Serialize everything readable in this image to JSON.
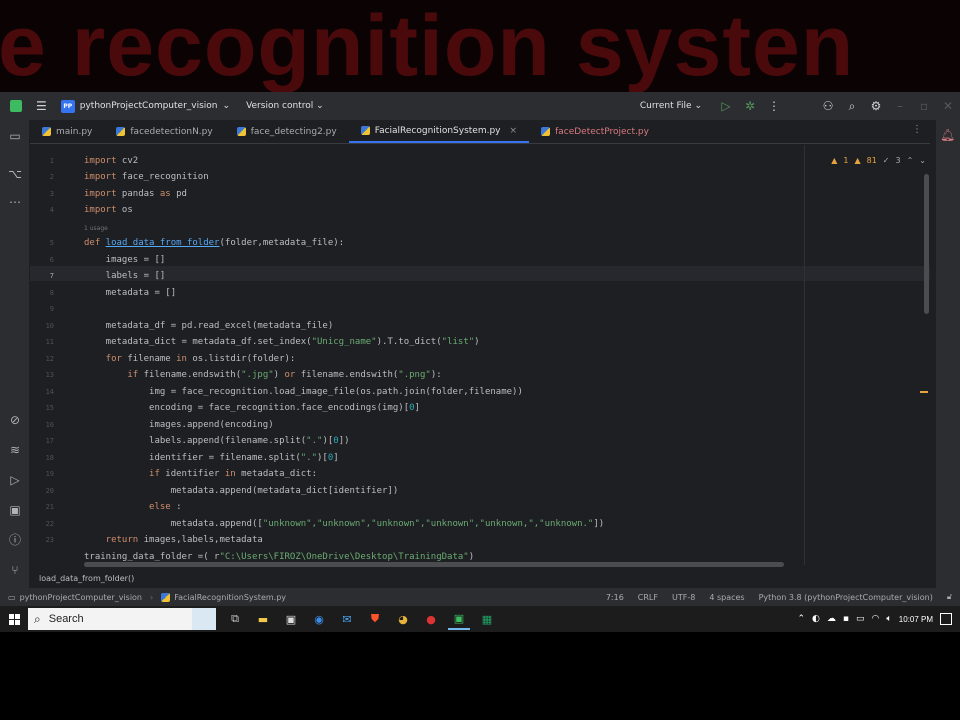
{
  "banner": {
    "text": "e recognition systen"
  },
  "titlebar": {
    "project": "pythonProjectComputer_vision",
    "project_badge": "PP",
    "vcs": "Version control",
    "run_config": "Current File"
  },
  "tabs": [
    {
      "label": "main.py"
    },
    {
      "label": "facedetectionN.py"
    },
    {
      "label": "face_detecting2.py"
    },
    {
      "label": "FacialRecognitionSystem.py",
      "active": true
    },
    {
      "label": "faceDetectProject.py"
    }
  ],
  "inspection": {
    "warnings": "1",
    "weak_warnings": "81",
    "typos": "3"
  },
  "code": {
    "line_numbers": [
      "1",
      "2",
      "3",
      "4",
      "5",
      "6",
      "7",
      "8",
      "9",
      "10",
      "11",
      "12",
      "13",
      "14",
      "15",
      "16",
      "17",
      "18",
      "19",
      "20",
      "21",
      "22",
      "23"
    ],
    "usages_hint": "1 usage",
    "lines": {
      "l1_kw": "import",
      "l1_rest": " cv2",
      "l2_kw": "import",
      "l2_rest": " face_recognition",
      "l3_kw": "import",
      "l3_rest": " pandas ",
      "l3_kw2": "as",
      "l3_rest2": " pd",
      "l4_kw": "import",
      "l4_rest": " os",
      "l5_kw": "def ",
      "l5_fn": "load_data_from_folder",
      "l5_rest": "(folder,metadata_file):",
      "l6": "    images = []",
      "l7": "    labels = []",
      "l8": "    metadata = []",
      "l10": "    metadata_df = pd.read_excel(metadata_file)",
      "l11_a": "    metadata_dict = metadata_df.set_index(",
      "l11_s1": "\"Unicg_name\"",
      "l11_b": ").T.to_dict(",
      "l11_s2": "\"list\"",
      "l11_c": ")",
      "l12_kw": "    for",
      "l12_a": " filename ",
      "l12_kw2": "in",
      "l12_b": " os.listdir(folder):",
      "l13_kw": "        if",
      "l13_a": " filename.endswith(",
      "l13_s1": "\".jpg\"",
      "l13_b": ") ",
      "l13_kw2": "or",
      "l13_c": " filename.endswith(",
      "l13_s2": "\".png\"",
      "l13_d": "):",
      "l14": "            img = face_recognition.load_image_file(os.path.join(folder,filename))",
      "l15_a": "            encoding = face_recognition.face_encodings(img)[",
      "l15_n": "0",
      "l15_b": "]",
      "l16": "            images.append(encoding)",
      "l17_a": "            labels.append(filename.split(",
      "l17_s": "\".\"",
      "l17_b": ")[",
      "l17_n": "0",
      "l17_c": "])",
      "l18_a": "            identifier = filename.split(",
      "l18_s": "\".\"",
      "l18_b": ")[",
      "l18_n": "0",
      "l18_c": "]",
      "l19_kw": "            if",
      "l19_a": " identifier ",
      "l19_kw2": "in",
      "l19_b": " metadata_dict:",
      "l20": "                metadata.append(metadata_dict[identifier])",
      "l21_kw": "            else",
      "l21_a": " :",
      "l22_a": "                metadata.append([",
      "l22_s": "\"unknown\",\"unknown\",\"unknown\",\"unknown\",\"unknown,\",\"unknown.\"",
      "l22_b": "])",
      "l23_kw": "    return",
      "l23_a": " images,labels,metadata",
      "l24_a": "training_data_folder =( r",
      "l24_s": "\"C:\\Users\\FIROZ\\OneDrive\\Desktop\\TrainingData\"",
      "l24_b": ")"
    }
  },
  "breadcrumb": "load_data_from_folder()",
  "status": {
    "project": "pythonProjectComputer_vision",
    "file": "FacialRecognitionSystem.py",
    "position": "7:16",
    "line_sep": "CRLF",
    "encoding": "UTF-8",
    "indent": "4 spaces",
    "interpreter": "Python 3.8 (pythonProjectComputer_vision)"
  },
  "taskbar": {
    "search_label": "Search",
    "time": "10:07 PM"
  }
}
